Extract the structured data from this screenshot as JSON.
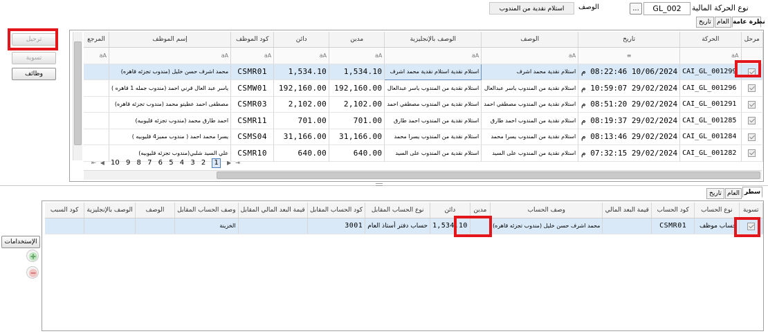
{
  "header": {
    "type_label": "نوع الحركة المالية",
    "type_value": "GL_002",
    "lookup_label": "...",
    "desc_label": "الوصف",
    "desc_value": "استلام نقدية من المندوب"
  },
  "top_tabs": {
    "general": "نظرة عامة",
    "common": "العام",
    "history": "تاريخ"
  },
  "side_buttons": {
    "post": "ترحيل",
    "settle": "تسوية",
    "functions": "وظائف"
  },
  "main_grid": {
    "columns": [
      "مرحل",
      "الحركة",
      "تاريخ",
      "الوصف",
      "الوصف بالإنجليزية",
      "مدين",
      "دائن",
      "كود الموظف",
      "إسم الموظف",
      "المرجع"
    ],
    "filter_marks": {
      "text": "aA",
      "date": "≡"
    },
    "rows": [
      {
        "id": "CAI_GL_001299",
        "date": "10/06/2024 08:22:46 م",
        "desc": "استلام نقدية محمد اشرف",
        "desc_en": "استلام نقدية استلام نقدية محمد اشرف",
        "debit": "1,534.10",
        "credit": "1,534.10",
        "emp_code": "CSMR01",
        "emp_name": "محمد اشرف حسن خليل (مندوب تجزئه قاهره)",
        "ref": ""
      },
      {
        "id": "CAI_GL_001296",
        "date": "29/02/2024 10:59:07 م",
        "desc": "استلام نقدية من المندوب ياسر عبدالعال",
        "desc_en": "استلام نقدية من المندوب ياسر عبدالعال",
        "debit": "192,160.00",
        "credit": "192,160.00",
        "emp_code": "CSMW01",
        "emp_name": "ياسر عبد العال قرني احمد (مندوب جمله 1 قاهره )",
        "ref": ""
      },
      {
        "id": "CAI_GL_001291",
        "date": "29/02/2024 08:51:20 م",
        "desc": "استلام نقدية من المندوب مصطفي احمد",
        "desc_en": "استلام نقدية من المندوب مصطفي احمد",
        "debit": "2,102.00",
        "credit": "2,102.00",
        "emp_code": "CSMR03",
        "emp_name": "مصطفى احمد عطيتو محمد (مندوب تجزئه قاهره)",
        "ref": ""
      },
      {
        "id": "CAI_GL_001285",
        "date": "29/02/2024 08:19:37 م",
        "desc": "استلام نقدية من المندوب احمد طارق",
        "desc_en": "استلام نقدية من المندوب احمد طارق",
        "debit": "701.00",
        "credit": "701.00",
        "emp_code": "CSMR11",
        "emp_name": "احمد طارق محمد (مندوب تجزئه قليوبيه)",
        "ref": ""
      },
      {
        "id": "CAI_GL_001284",
        "date": "29/02/2024 08:13:46 م",
        "desc": "استلام نقدية من المندوب يسرا محمد",
        "desc_en": "استلام نقدية من المندوب يسرا محمد",
        "debit": "31,166.00",
        "credit": "31,166.00",
        "emp_code": "CSMS04",
        "emp_name": "يسرا محمد احمد ( مندوب مميز4 قليوبيه )",
        "ref": ""
      },
      {
        "id": "CAI_GL_001282",
        "date": "29/02/2024 07:32:15 م",
        "desc": "استلام نقدية من المندوب على السيد",
        "desc_en": "استلام نقدية من المندوب على السيد",
        "debit": "640.00",
        "credit": "640.00",
        "emp_code": "CSMR10",
        "emp_name": "علي السيد شلبي(مندوب تجزئه قليوبيه)",
        "ref": ""
      }
    ],
    "pager": {
      "first": "⇤",
      "prev": "◀",
      "pages": [
        "10",
        "9",
        "8",
        "7",
        "6",
        "5",
        "4",
        "3",
        "2",
        "1"
      ],
      "current": "1",
      "next": "▶",
      "last": "⇥"
    }
  },
  "detail_tabs": {
    "lines": "سطر",
    "common": "العام",
    "history": "تاريخ"
  },
  "side_labels": {
    "uses": "الإستخدامات"
  },
  "detail_grid": {
    "columns": [
      "تسوية",
      "نوع الحساب",
      "كود الحساب",
      "قيمة البعد المالي",
      "وصف الحساب",
      "مدين",
      "دائن",
      "نوع الحساب المقابل",
      "كود الحساب المقابل",
      "قيمة البعد المالي المقابل",
      "وصف الحساب المقابل",
      "الوصف",
      "الوصف بالإنجليزية",
      "كود السبب"
    ],
    "rows": [
      {
        "acct_type": "حساب موظف",
        "acct_code": "CSMR01",
        "dim": "",
        "acct_desc": "محمد اشرف حسن خليل (مندوب تجزئه قاهره)",
        "debit": "",
        "credit": "1,534.10",
        "offset_type": "حساب دفتر أستاذ العام",
        "offset_code": "3001",
        "offset_dim": "",
        "offset_desc": "الخزينة",
        "desc": "",
        "desc_en": "",
        "reason": ""
      }
    ]
  },
  "colors": {
    "highlight": "#e3161b",
    "selected_row": "#d9e9f8"
  }
}
